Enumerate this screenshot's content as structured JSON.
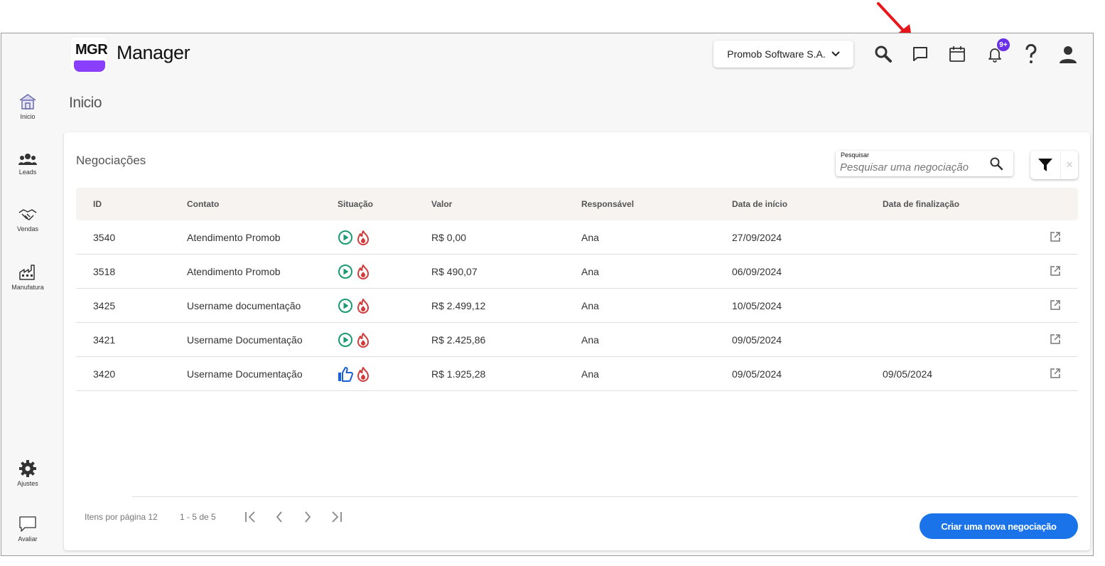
{
  "app": {
    "logo_text": "MGR",
    "title": "Manager",
    "company": "Promob Software S.A.",
    "notifications_badge": "9+"
  },
  "sidebar": {
    "items": [
      {
        "label": "Inicio",
        "icon": "home-icon"
      },
      {
        "label": "Leads",
        "icon": "people-icon"
      },
      {
        "label": "Vendas",
        "icon": "handshake-icon"
      },
      {
        "label": "Manufatura",
        "icon": "factory-icon"
      },
      {
        "label": "Ajustes",
        "icon": "gear-icon"
      },
      {
        "label": "Avaliar",
        "icon": "chat-bubble-icon"
      }
    ]
  },
  "page": {
    "title": "Inicio"
  },
  "card": {
    "title": "Negociações",
    "search_label": "Pesquisar",
    "search_placeholder": "Pesquisar uma negociação",
    "columns": [
      "ID",
      "Contato",
      "Situação",
      "Valor",
      "Responsável",
      "Data de início",
      "Data de finalização"
    ],
    "rows": [
      {
        "id": "3540",
        "contato": "Atendimento Promob",
        "situacao": [
          "play-circle-icon",
          "flame-icon"
        ],
        "valor": "R$ 0,00",
        "responsavel": "Ana",
        "inicio": "27/09/2024",
        "finalizacao": ""
      },
      {
        "id": "3518",
        "contato": "Atendimento Promob",
        "situacao": [
          "play-circle-icon",
          "flame-icon"
        ],
        "valor": "R$ 490,07",
        "responsavel": "Ana",
        "inicio": "06/09/2024",
        "finalizacao": ""
      },
      {
        "id": "3425",
        "contato": "Username documentação",
        "situacao": [
          "play-circle-icon",
          "flame-icon"
        ],
        "valor": "R$ 2.499,12",
        "responsavel": "Ana",
        "inicio": "10/05/2024",
        "finalizacao": ""
      },
      {
        "id": "3421",
        "contato": "Username Documentação",
        "situacao": [
          "play-circle-icon",
          "flame-icon"
        ],
        "valor": "R$ 2.425,86",
        "responsavel": "Ana",
        "inicio": "09/05/2024",
        "finalizacao": ""
      },
      {
        "id": "3420",
        "contato": "Username Documentação",
        "situacao": [
          "thumbs-up-icon",
          "flame-icon"
        ],
        "valor": "R$ 1.925,28",
        "responsavel": "Ana",
        "inicio": "09/05/2024",
        "finalizacao": "09/05/2024"
      }
    ]
  },
  "pagination": {
    "items_per_page": "Itens por página 12",
    "range": "1 - 5 de 5"
  },
  "actions": {
    "create": "Criar uma nova negociação"
  },
  "colors": {
    "accent": "#1a73e8",
    "badge": "#6a2ee8",
    "status_green": "#1a9a6e",
    "status_red": "#d33b3b",
    "annotation_arrow": "#e8161b"
  }
}
